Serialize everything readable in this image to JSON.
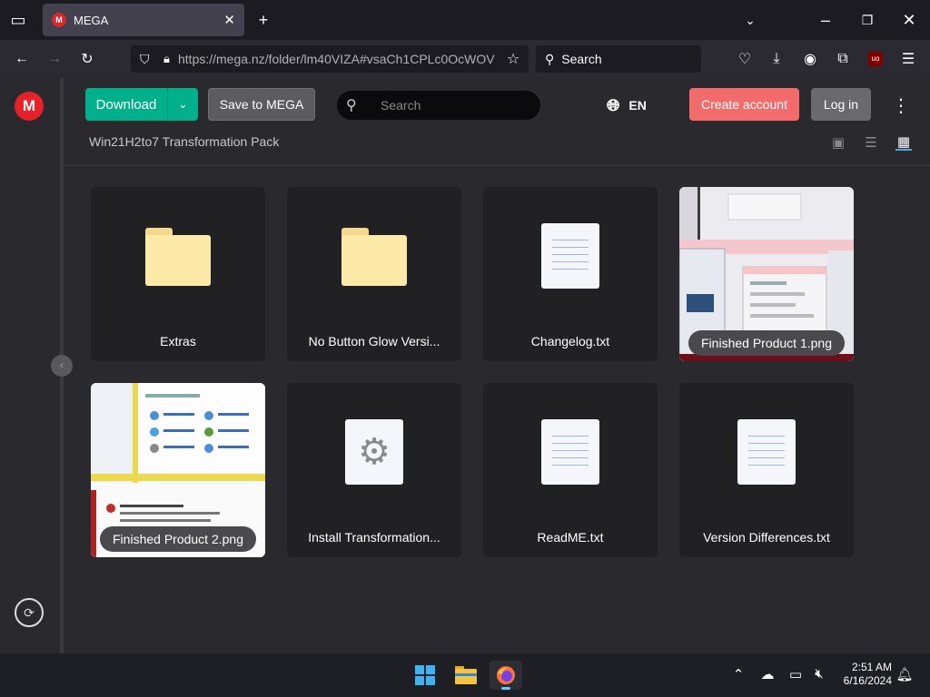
{
  "browser": {
    "tab_title": "MEGA",
    "tab_favicon": "M",
    "url": "https://mega.nz/folder/lm40VIZA#vsaCh1CPLc0OcWOV",
    "search_placeholder": "Search"
  },
  "mega": {
    "logo": "M",
    "download_label": "Download",
    "save_label": "Save to MEGA",
    "search_placeholder": "Search",
    "language": "EN",
    "create_account_label": "Create account",
    "login_label": "Log in",
    "folder_title": "Win21H2to7 Transformation Pack",
    "items": [
      {
        "name": "Extras",
        "type": "folder"
      },
      {
        "name": "No Button Glow Versi...",
        "type": "folder"
      },
      {
        "name": "Changelog.txt",
        "type": "text"
      },
      {
        "name": "Finished Product 1.png",
        "type": "image"
      },
      {
        "name": "Finished Product 2.png",
        "type": "image"
      },
      {
        "name": "Install Transformation...",
        "type": "exe"
      },
      {
        "name": "ReadME.txt",
        "type": "text"
      },
      {
        "name": "Version Differences.txt",
        "type": "text"
      }
    ]
  },
  "taskbar": {
    "time": "2:51 AM",
    "date": "6/16/2024"
  },
  "colors": {
    "accent_green": "#00b08a",
    "create_red": "#f36c6c",
    "mega_red": "#e52129"
  }
}
